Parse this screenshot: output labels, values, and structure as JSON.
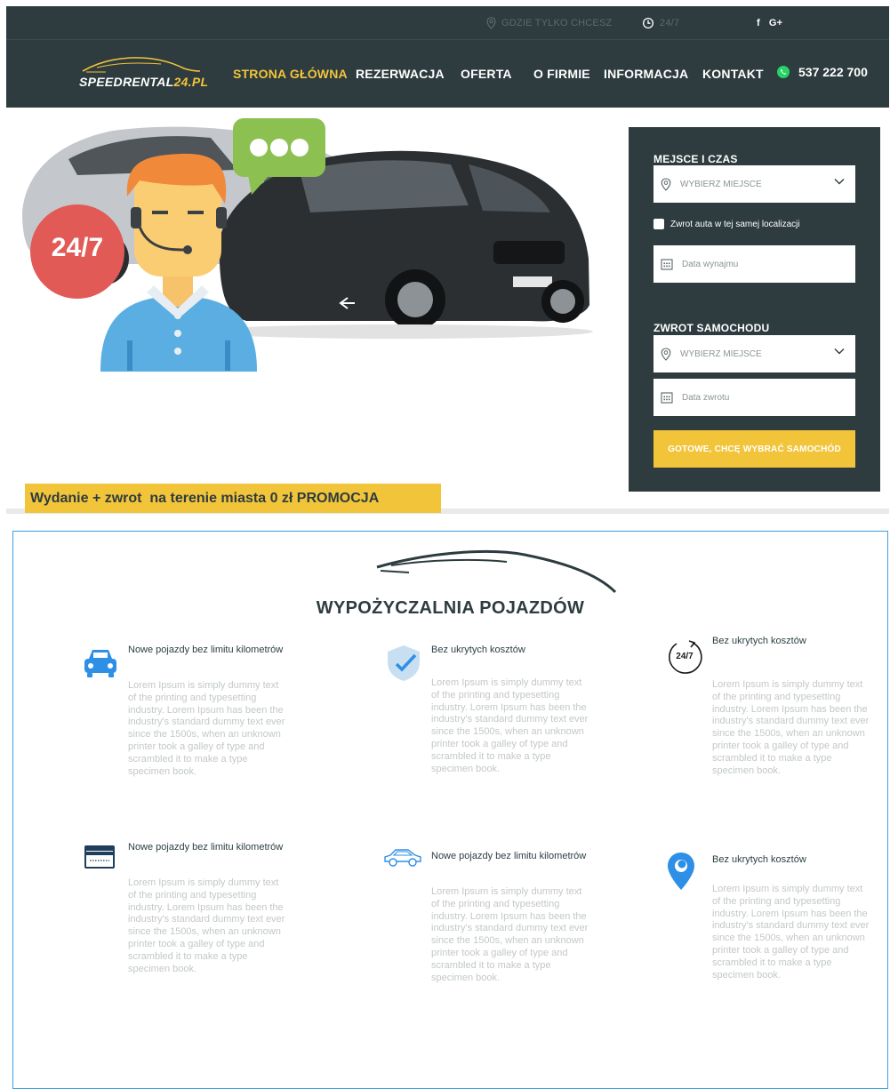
{
  "topbar": {
    "location_text": "GDZIE TYLKO CHCESZ",
    "hours_text": "24/7",
    "social": {
      "facebook": "f",
      "google": "G+"
    }
  },
  "brand": {
    "name_main": "SPEEDRENTAL",
    "name_suffix": "24.PL"
  },
  "nav": {
    "items": [
      {
        "label": "STRONA GŁÓWNA",
        "active": true
      },
      {
        "label": "REZERWACJA"
      },
      {
        "label": "OFERTA"
      },
      {
        "label": "O FIRMIE"
      },
      {
        "label": "INFORMACJA"
      },
      {
        "label": "KONTAKT"
      }
    ],
    "phone": "537 222 700"
  },
  "hero": {
    "badge": "24/7",
    "promo": "Wydanie + zwrot  na terenie miasta 0 zł PROMOCJA"
  },
  "booking": {
    "pickup_heading": "MEJSCE I CZAS",
    "pickup_place_placeholder": "WYBIERZ MIEJSCE",
    "same_location_label": "Zwrot auta w tej samej localizacji",
    "rental_date_placeholder": "Data wynajmu",
    "return_heading": "ZWROT SAMOCHODU",
    "return_place_placeholder": "WYBIERZ MIEJSCE",
    "return_date_placeholder": "Data zwrotu",
    "submit_label": "GOTOWE, CHCĘ WYBRAĆ SAMOCHÓD"
  },
  "features": {
    "title": "WYPOŻYCZALNIA POJAZDÓW",
    "items": [
      {
        "icon": "car-front-icon",
        "title": "Nowe pojazdy bez limitu kilometrów",
        "text": "Lorem Ipsum is simply dummy text of the printing and typesetting industry. Lorem Ipsum has been the industry's standard dummy text ever since the 1500s, when an unknown printer took a galley of type and scrambled it to make a type specimen book."
      },
      {
        "icon": "shield-check-icon",
        "title": "Bez ukrytych kosztów",
        "text": "Lorem Ipsum is simply dummy text of the printing and typesetting industry. Lorem Ipsum has been the industry's standard dummy text ever since the 1500s, when an unknown printer took a galley of type and scrambled it to make a type specimen book."
      },
      {
        "icon": "clock-24-7-icon",
        "icon_text": "24/7",
        "title": "Bez ukrytych kosztów",
        "text": "Lorem Ipsum is simply dummy text of the printing and typesetting industry. Lorem Ipsum has been the industry's standard dummy text ever since the 1500s, when an unknown printer took a galley of type and scrambled it to make a type specimen book."
      },
      {
        "icon": "credit-card-icon",
        "title": "Nowe pojazdy bez limitu kilometrów",
        "text": "Lorem Ipsum is simply dummy text of the printing and typesetting industry. Lorem Ipsum has been the industry's standard dummy text ever since the 1500s, when an unknown printer took a galley of type and scrambled it to make a type specimen book."
      },
      {
        "icon": "car-side-icon",
        "title": "Nowe pojazdy bez limitu kilometrów",
        "text": "Lorem Ipsum is simply dummy text of the printing and typesetting industry. Lorem Ipsum has been the industry's standard dummy text ever since the 1500s, when an unknown printer took a galley of type and scrambled it to make a type specimen book."
      },
      {
        "icon": "map-pin-icon",
        "title": "Bez ukrytych kosztów",
        "text": "Lorem Ipsum is simply dummy text of the printing and typesetting industry. Lorem Ipsum has been the industry's standard dummy text ever since the 1500s, when an unknown printer took a galley of type and scrambled it to make a type specimen book."
      }
    ]
  },
  "colors": {
    "dark": "#2e3c3f",
    "accent": "#f2c43a",
    "icon_blue": "#2e8fe6",
    "muted_text": "#c3c8c9"
  }
}
